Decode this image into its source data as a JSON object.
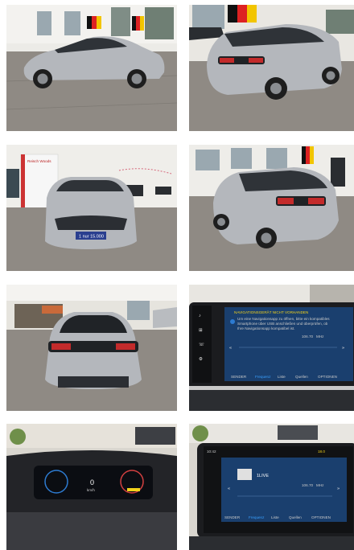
{
  "gallery": {
    "photos": [
      {
        "name": "photo-side-view"
      },
      {
        "name": "photo-rear-quarter-right"
      },
      {
        "name": "photo-front-view"
      },
      {
        "name": "photo-rear-quarter-left"
      },
      {
        "name": "photo-rear-view"
      },
      {
        "name": "photo-navigation-screen"
      },
      {
        "name": "photo-instrument-cluster"
      },
      {
        "name": "photo-radio-screen"
      }
    ],
    "front_view": {
      "sign_text": "Reisch Woods",
      "plate_text": "1 nur 15.000"
    },
    "navigation_screen": {
      "title": "NAVIGATIONSGERÄT NICHT VORHANDEN",
      "message_lines": [
        "Um eine Navigationsapp zu öffnen, bitte ein kompatibles",
        "Smartphone über USB anschließen und überprüfen, ob",
        "Ihre Navigationsapp kompatibel ist."
      ],
      "frequency": "106.70",
      "unit": "MHz",
      "tabs": [
        "SENDER",
        "Frequenz",
        "Liste",
        "Quellen",
        "OPTIONEN"
      ]
    },
    "instrument_cluster": {
      "speed": "0",
      "unit": "km/h"
    },
    "radio_screen": {
      "time": "10:42",
      "temperature": "18.0",
      "station": "1LIVE",
      "frequency": "106.70",
      "unit": "MHz",
      "tabs": [
        "SENDER",
        "Frequenz",
        "Liste",
        "Quellen",
        "OPTIONEN"
      ]
    },
    "colors": {
      "car_silver": "#b4b7bc",
      "floor": "#8f8a84",
      "wall": "#ecebe7",
      "screen_blue": "#1a3f6e",
      "warning_yellow": "#f2d21b"
    }
  }
}
